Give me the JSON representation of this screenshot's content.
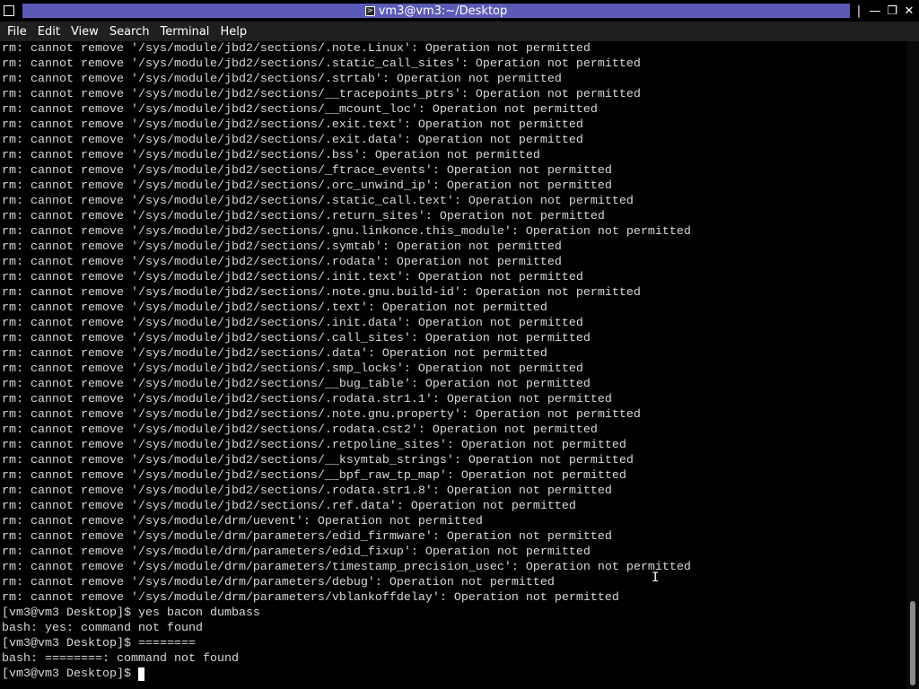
{
  "window": {
    "title": "vm3@vm3:~/Desktop",
    "separator_glyph": "|",
    "minimize_glyph": "—",
    "maximize_glyph": "❐",
    "close_glyph": "✕",
    "title_bar_color": "#5b5bb7"
  },
  "menu": {
    "items": [
      "File",
      "Edit",
      "View",
      "Search",
      "Terminal",
      "Help"
    ]
  },
  "terminal": {
    "lines": [
      "rm: cannot remove '/sys/module/jbd2/sections/.note.Linux': Operation not permitted",
      "rm: cannot remove '/sys/module/jbd2/sections/.static_call_sites': Operation not permitted",
      "rm: cannot remove '/sys/module/jbd2/sections/.strtab': Operation not permitted",
      "rm: cannot remove '/sys/module/jbd2/sections/__tracepoints_ptrs': Operation not permitted",
      "rm: cannot remove '/sys/module/jbd2/sections/__mcount_loc': Operation not permitted",
      "rm: cannot remove '/sys/module/jbd2/sections/.exit.text': Operation not permitted",
      "rm: cannot remove '/sys/module/jbd2/sections/.exit.data': Operation not permitted",
      "rm: cannot remove '/sys/module/jbd2/sections/.bss': Operation not permitted",
      "rm: cannot remove '/sys/module/jbd2/sections/_ftrace_events': Operation not permitted",
      "rm: cannot remove '/sys/module/jbd2/sections/.orc_unwind_ip': Operation not permitted",
      "rm: cannot remove '/sys/module/jbd2/sections/.static_call.text': Operation not permitted",
      "rm: cannot remove '/sys/module/jbd2/sections/.return_sites': Operation not permitted",
      "rm: cannot remove '/sys/module/jbd2/sections/.gnu.linkonce.this_module': Operation not permitted",
      "rm: cannot remove '/sys/module/jbd2/sections/.symtab': Operation not permitted",
      "rm: cannot remove '/sys/module/jbd2/sections/.rodata': Operation not permitted",
      "rm: cannot remove '/sys/module/jbd2/sections/.init.text': Operation not permitted",
      "rm: cannot remove '/sys/module/jbd2/sections/.note.gnu.build-id': Operation not permitted",
      "rm: cannot remove '/sys/module/jbd2/sections/.text': Operation not permitted",
      "rm: cannot remove '/sys/module/jbd2/sections/.init.data': Operation not permitted",
      "rm: cannot remove '/sys/module/jbd2/sections/.call_sites': Operation not permitted",
      "rm: cannot remove '/sys/module/jbd2/sections/.data': Operation not permitted",
      "rm: cannot remove '/sys/module/jbd2/sections/.smp_locks': Operation not permitted",
      "rm: cannot remove '/sys/module/jbd2/sections/__bug_table': Operation not permitted",
      "rm: cannot remove '/sys/module/jbd2/sections/.rodata.str1.1': Operation not permitted",
      "rm: cannot remove '/sys/module/jbd2/sections/.note.gnu.property': Operation not permitted",
      "rm: cannot remove '/sys/module/jbd2/sections/.rodata.cst2': Operation not permitted",
      "rm: cannot remove '/sys/module/jbd2/sections/.retpoline_sites': Operation not permitted",
      "rm: cannot remove '/sys/module/jbd2/sections/__ksymtab_strings': Operation not permitted",
      "rm: cannot remove '/sys/module/jbd2/sections/__bpf_raw_tp_map': Operation not permitted",
      "rm: cannot remove '/sys/module/jbd2/sections/.rodata.str1.8': Operation not permitted",
      "rm: cannot remove '/sys/module/jbd2/sections/.ref.data': Operation not permitted",
      "rm: cannot remove '/sys/module/drm/uevent': Operation not permitted",
      "rm: cannot remove '/sys/module/drm/parameters/edid_firmware': Operation not permitted",
      "rm: cannot remove '/sys/module/drm/parameters/edid_fixup': Operation not permitted",
      "rm: cannot remove '/sys/module/drm/parameters/timestamp_precision_usec': Operation not permitted",
      "rm: cannot remove '/sys/module/drm/parameters/debug': Operation not permitted",
      "rm: cannot remove '/sys/module/drm/parameters/vblankoffdelay': Operation not permitted",
      "[vm3@vm3 Desktop]$ yes bacon dumbass",
      "bash: yes: command not found",
      "[vm3@vm3 Desktop]$ ========",
      "bash: ========: command not found"
    ],
    "prompt": "[vm3@vm3 Desktop]$ ",
    "input_value": ""
  }
}
